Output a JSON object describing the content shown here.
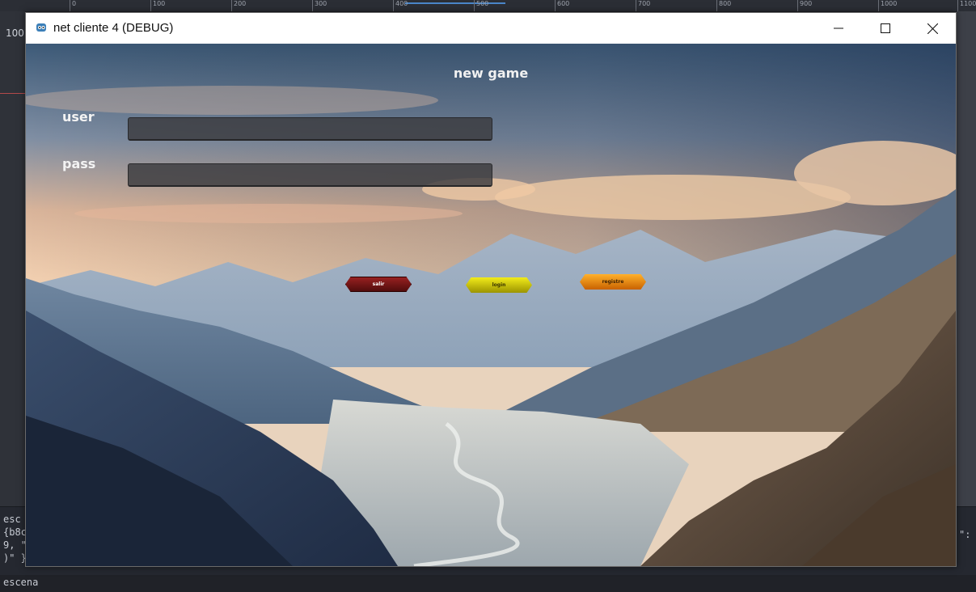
{
  "editor": {
    "ruler_ticks": [
      "0",
      "100",
      "200",
      "300",
      "400",
      "500",
      "600",
      "700",
      "800",
      "900",
      "1000",
      "1100"
    ],
    "left_ruler_label": "100",
    "console_lines": [
      "esc",
      "{b8c",
      "9, \"",
      ")\" }"
    ],
    "console_right_snip": "\":",
    "bottom_label": "escena"
  },
  "window": {
    "title": "net cliente 4 (DEBUG)",
    "minimize_glyph": "—",
    "maximize_glyph": "☐",
    "close_glyph": "✕"
  },
  "game": {
    "heading": "new game",
    "user_label": "user",
    "pass_label": "pass",
    "user_value": "",
    "pass_value": "",
    "buttons": {
      "exit_label": "salir",
      "login_label": "login",
      "register_label": "registre"
    },
    "colors": {
      "exit": "#8b1a1a",
      "login": "#e6df15",
      "register": "#f39a12"
    }
  }
}
